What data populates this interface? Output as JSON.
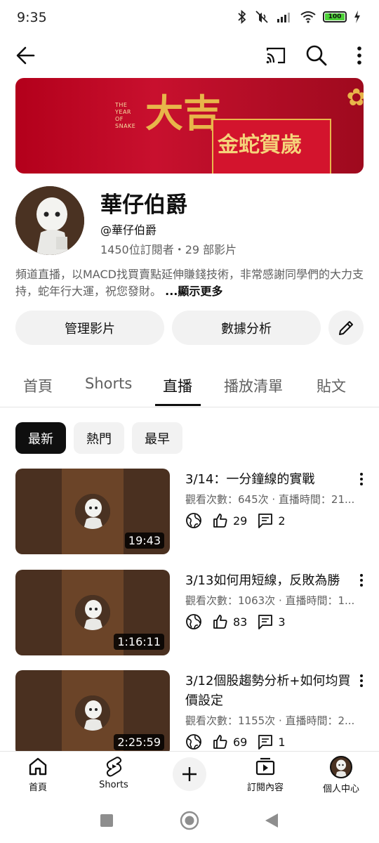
{
  "status_bar": {
    "time": "9:35",
    "battery": "100",
    "icons": [
      "bluetooth-icon",
      "mute-icon",
      "signal-icon",
      "wifi-icon",
      "battery-icon",
      "charging-icon"
    ]
  },
  "app_bar": {
    "icons": [
      "back-arrow-icon",
      "cast-icon",
      "search-icon",
      "more-vert-icon"
    ]
  },
  "banner": {
    "year_text": [
      "THE",
      "YEAR",
      "OF",
      "SNAKE"
    ],
    "big_char": "大吉",
    "red_text": "金蛇賀歲",
    "colors": {
      "red": "#c8102e",
      "gold": "#e8b64a"
    }
  },
  "channel": {
    "name": "華仔伯爵",
    "handle": "@華仔伯爵",
    "stats": "1450位訂閱者・29 部影片",
    "description": "頻道直播，以MACD找買賣點延伸賺錢技術，非常感謝同學們的大力支持，蛇年行大運，祝您發財。",
    "more_label": "...顯示更多"
  },
  "actions": {
    "manage_label": "管理影片",
    "analytics_label": "數據分析",
    "edit_icon": "pencil-icon"
  },
  "tabs": [
    "首頁",
    "Shorts",
    "直播",
    "播放清單",
    "貼文"
  ],
  "active_tab": "直播",
  "chips": [
    "最新",
    "熱門",
    "最早"
  ],
  "active_chip": "最新",
  "videos": [
    {
      "title": "3/14：一分鐘線的實戰",
      "meta": "觀看次數：645次 · 直播時間：21...",
      "duration": "19:43",
      "likes": "29",
      "comments": "2"
    },
    {
      "title": "3/13如何用短線，反敗為勝",
      "meta": "觀看次數：1063次 · 直播時間：1...",
      "duration": "1:16:11",
      "likes": "83",
      "comments": "3"
    },
    {
      "title": "3/12個股趨勢分析+如何均買價設定",
      "meta": "觀看次數：1155次 · 直播時間：2...",
      "duration": "2:25:59",
      "likes": "69",
      "comments": "1"
    }
  ],
  "bottom_nav": {
    "home": "首頁",
    "shorts": "Shorts",
    "subscriptions": "訂閱內容",
    "profile": "個人中心"
  }
}
